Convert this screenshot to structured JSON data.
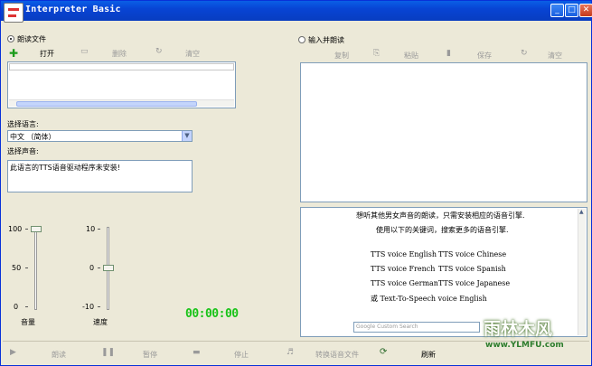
{
  "window": {
    "title": "Interpreter Basic",
    "min": "_",
    "max": "□",
    "close": "✕"
  },
  "left": {
    "radio_file": "朗读文件",
    "toolbar": {
      "open": "打开",
      "delete": "删除",
      "clear": "清空"
    },
    "language_label": "选择语言:",
    "language_value": "中文 （简体）",
    "voice_label": "选择声音:",
    "voice_text": "此语言的TTS语音驱动程序未安装!",
    "volume": {
      "ticks": [
        "100",
        "50",
        "0"
      ],
      "label": "音量",
      "level": 0.0
    },
    "speed": {
      "ticks": [
        "10",
        "0",
        "-10"
      ],
      "label": "速度",
      "level": 0.5
    },
    "timer": "00:00:00"
  },
  "right": {
    "radio_input": "输入并朗读",
    "toolbar": {
      "copy": "复制",
      "paste": "粘贴",
      "save": "保存",
      "clear": "清空"
    },
    "help": {
      "line1": "想听其他男女声音的朗读，只需安装相应的语音引擎.",
      "line2": "使用以下的关键词，搜索更多的语音引擎.",
      "k1a": "TTS voice English",
      "k1b": "TTS voice Chinese",
      "k2a": "TTS voice French",
      "k2b": "TTS voice Spanish",
      "k3a": "TTS voice German",
      "k3b": "TTS voice Japanese",
      "k4": "或 Text-To-Speech voice English",
      "search_placeholder": "Google Custom Search"
    }
  },
  "bottom": {
    "read": "朗读",
    "pause": "暂停",
    "stop": "停止",
    "convert": "转换语音文件",
    "refresh": "刷新"
  },
  "watermark": {
    "brand": "雨林木风",
    "url": "www.YLMFU.com"
  }
}
